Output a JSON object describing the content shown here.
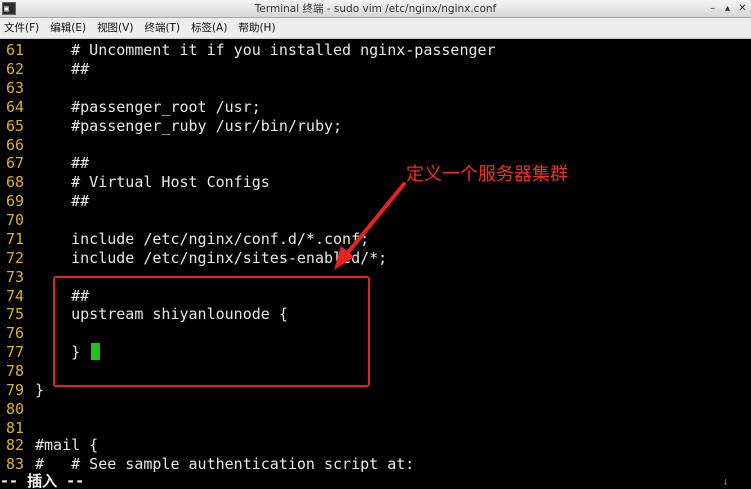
{
  "window": {
    "title": "Terminal 终端 - sudo vim /etc/nginx/nginx.conf",
    "app_icon_glyph": "▣",
    "minimize_glyph": "–",
    "maximize_glyph": "▴",
    "close_glyph": "✕"
  },
  "menu": [
    {
      "label": "文件(F)"
    },
    {
      "label": "编辑(E)"
    },
    {
      "label": "视图(V)"
    },
    {
      "label": "终端(T)"
    },
    {
      "label": "标签(A)"
    },
    {
      "label": "帮助(H)"
    }
  ],
  "editor": {
    "lines": [
      {
        "num": "61",
        "text": "    # Uncomment it if you installed nginx-passenger"
      },
      {
        "num": "62",
        "text": "    ##"
      },
      {
        "num": "63",
        "text": ""
      },
      {
        "num": "64",
        "text": "    #passenger_root /usr;"
      },
      {
        "num": "65",
        "text": "    #passenger_ruby /usr/bin/ruby;"
      },
      {
        "num": "66",
        "text": ""
      },
      {
        "num": "67",
        "text": "    ##"
      },
      {
        "num": "68",
        "text": "    # Virtual Host Configs"
      },
      {
        "num": "69",
        "text": "    ##"
      },
      {
        "num": "70",
        "text": ""
      },
      {
        "num": "71",
        "text": "    include /etc/nginx/conf.d/*.conf;"
      },
      {
        "num": "72",
        "text": "    include /etc/nginx/sites-enabled/*;"
      },
      {
        "num": "73",
        "text": ""
      },
      {
        "num": "74",
        "text": "    ##"
      },
      {
        "num": "75",
        "text": "    upstream shiyanlounode {"
      },
      {
        "num": "76",
        "text": ""
      },
      {
        "num": "77",
        "text": "    }"
      },
      {
        "num": "78",
        "text": ""
      },
      {
        "num": "79",
        "text": "}"
      },
      {
        "num": "80",
        "text": ""
      },
      {
        "num": "81",
        "text": ""
      },
      {
        "num": "82",
        "text": "#mail {"
      },
      {
        "num": "83",
        "text": "#   # See sample authentication script at:"
      }
    ],
    "mode_status": "-- 插入 --",
    "right_status": "↓"
  },
  "annotation": {
    "label": "定义一个服务器集群",
    "color": "#e8231c"
  },
  "colors": {
    "line_number": "#e0b020",
    "cursor": "#1ec21e",
    "background": "#000000",
    "text": "#e8e8e8"
  }
}
